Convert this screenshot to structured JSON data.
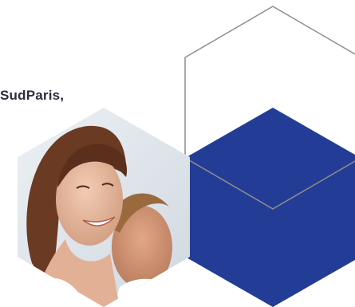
{
  "headline": {
    "text": "SudParis,"
  },
  "colors": {
    "hex_fill": "#233d96",
    "outline": "#8e8e8e",
    "text": "#2b2d3a",
    "skin": "#e7b9a0",
    "hair_woman": "#6b3a22",
    "hair_man": "#9a6a3e",
    "background": "#ffffff"
  },
  "photo": {
    "subject": "smiling-woman-and-man-photo"
  }
}
